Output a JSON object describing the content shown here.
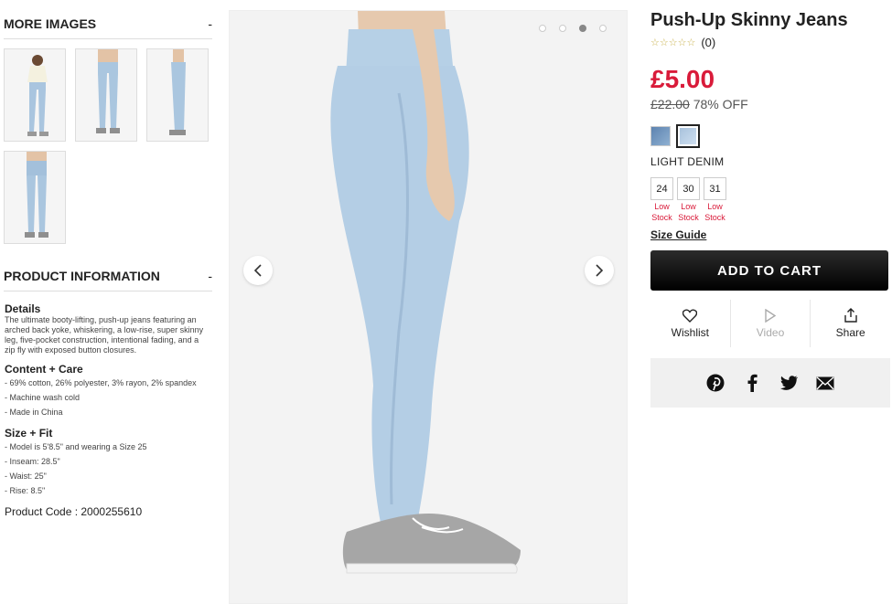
{
  "left": {
    "more_images_title": "MORE IMAGES",
    "more_images_toggle": "-",
    "product_info_title": "PRODUCT INFORMATION",
    "product_info_toggle": "-",
    "details_heading": "Details",
    "details_text": "The ultimate booty-lifting, push-up jeans featuring an arched back yoke, whiskering, a low-rise, super skinny leg, five-pocket construction, intentional fading, and a zip fly with exposed button closures.",
    "content_heading": "Content + Care",
    "content_items": [
      "- 69% cotton, 26% polyester, 3% rayon, 2% spandex",
      "- Machine wash cold",
      "- Made in China"
    ],
    "fit_heading": "Size + Fit",
    "fit_items": [
      "- Model is 5'8.5\" and wearing a Size 25",
      "- Inseam: 28.5\"",
      "- Waist: 25\"",
      "- Rise: 8.5\""
    ],
    "product_code": "Product Code : 2000255610"
  },
  "product": {
    "title": "Push-Up Skinny Jeans",
    "stars": "☆☆☆☆☆",
    "rating_count": "(0)",
    "price": "£5.00",
    "old_price": "£22.00",
    "discount": "78% OFF",
    "color_name": "LIGHT DENIM",
    "sizes": [
      {
        "size": "24",
        "note1": "Low",
        "note2": "Stock"
      },
      {
        "size": "30",
        "note1": "Low",
        "note2": "Stock"
      },
      {
        "size": "31",
        "note1": "Low",
        "note2": "Stock"
      }
    ],
    "size_guide": "Size Guide",
    "add_to_cart": "ADD TO CART",
    "wishlist": "Wishlist",
    "video": "Video",
    "share": "Share"
  },
  "colors": {
    "price_red": "#d91b3a",
    "swatch_dark_denim": "#6f93bd",
    "swatch_light_denim": "#b7cde2",
    "button_black": "#000000"
  }
}
